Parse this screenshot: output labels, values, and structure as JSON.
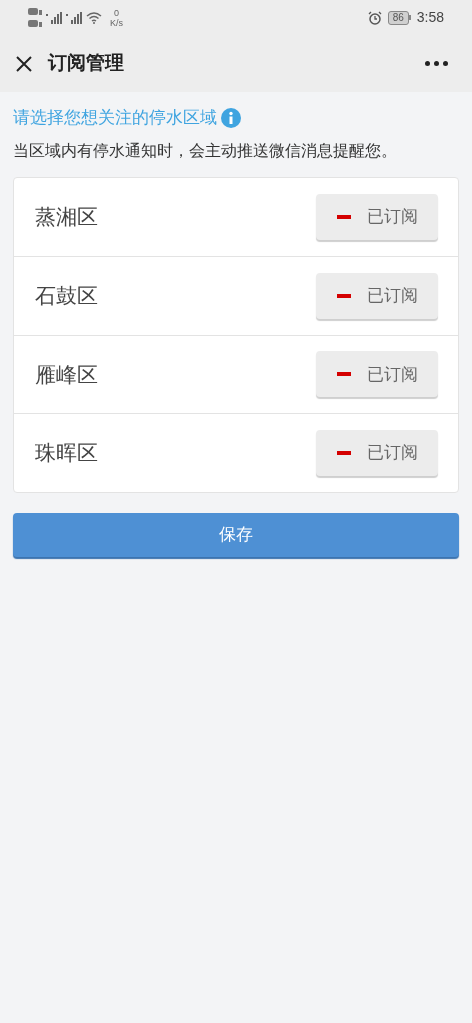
{
  "status_bar": {
    "speed_value": "0",
    "speed_unit": "K/s",
    "battery": "86",
    "time": "3:58"
  },
  "header": {
    "title": "订阅管理"
  },
  "intro": {
    "prompt": "请选择您想关注的停水区域",
    "note": "当区域内有停水通知时，会主动推送微信消息提醒您。"
  },
  "districts": [
    {
      "name": "蒸湘区",
      "button": "已订阅",
      "subscribed": true
    },
    {
      "name": "石鼓区",
      "button": "已订阅",
      "subscribed": true
    },
    {
      "name": "雁峰区",
      "button": "已订阅",
      "subscribed": true
    },
    {
      "name": "珠晖区",
      "button": "已订阅",
      "subscribed": true
    }
  ],
  "save_button": "保存"
}
